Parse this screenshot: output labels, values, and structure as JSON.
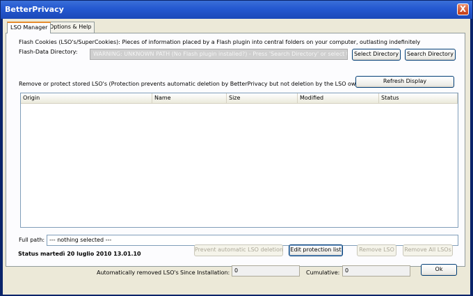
{
  "window": {
    "title": "BetterPrivacy",
    "close": "X"
  },
  "tabs": [
    {
      "label": "LSO Manager",
      "active": true
    },
    {
      "label": "Options & Help",
      "active": false
    }
  ],
  "main": {
    "description": "Flash Cookies (LSO's/SuperCookies): Pieces of information placed by a Flash plugin into central folders on your computer, outlasting indefinitely",
    "dir_label": "Flash-Data Directory:",
    "dir_value": "WARNING: UNKNOWN PATH (No Flash plugin installed?) - Press 'Search Directory' or select the fl",
    "select_dir_btn": "Select Directory",
    "search_dir_btn": "Search Directory",
    "protect_info": "Remove or protect stored LSO's (Protection prevents automatic deletion by BetterPrivacy but not deletion by the LSO owner!)",
    "refresh_btn": "Refresh Display",
    "columns": [
      "Origin",
      "Name",
      "Size",
      "Modified",
      "Status"
    ],
    "full_path_label": "Full path:",
    "full_path_value": "--- nothing selected ---",
    "status": "Status martedì 20 luglio 2010 13.01.10",
    "prevent_btn": "Prevent automatic LSO deletion",
    "edit_protection_btn": "Edit protection list",
    "remove_btn": "Remove LSO",
    "remove_all_btn": "Remove All LSOs"
  },
  "footer": {
    "auto_removed_label": "Automatically removed LSO's",
    "since_install_label": "Since Installation:",
    "since_install_value": "0",
    "cumulative_label": "Cumulative:",
    "cumulative_value": "0",
    "ok_btn": "Ok"
  }
}
